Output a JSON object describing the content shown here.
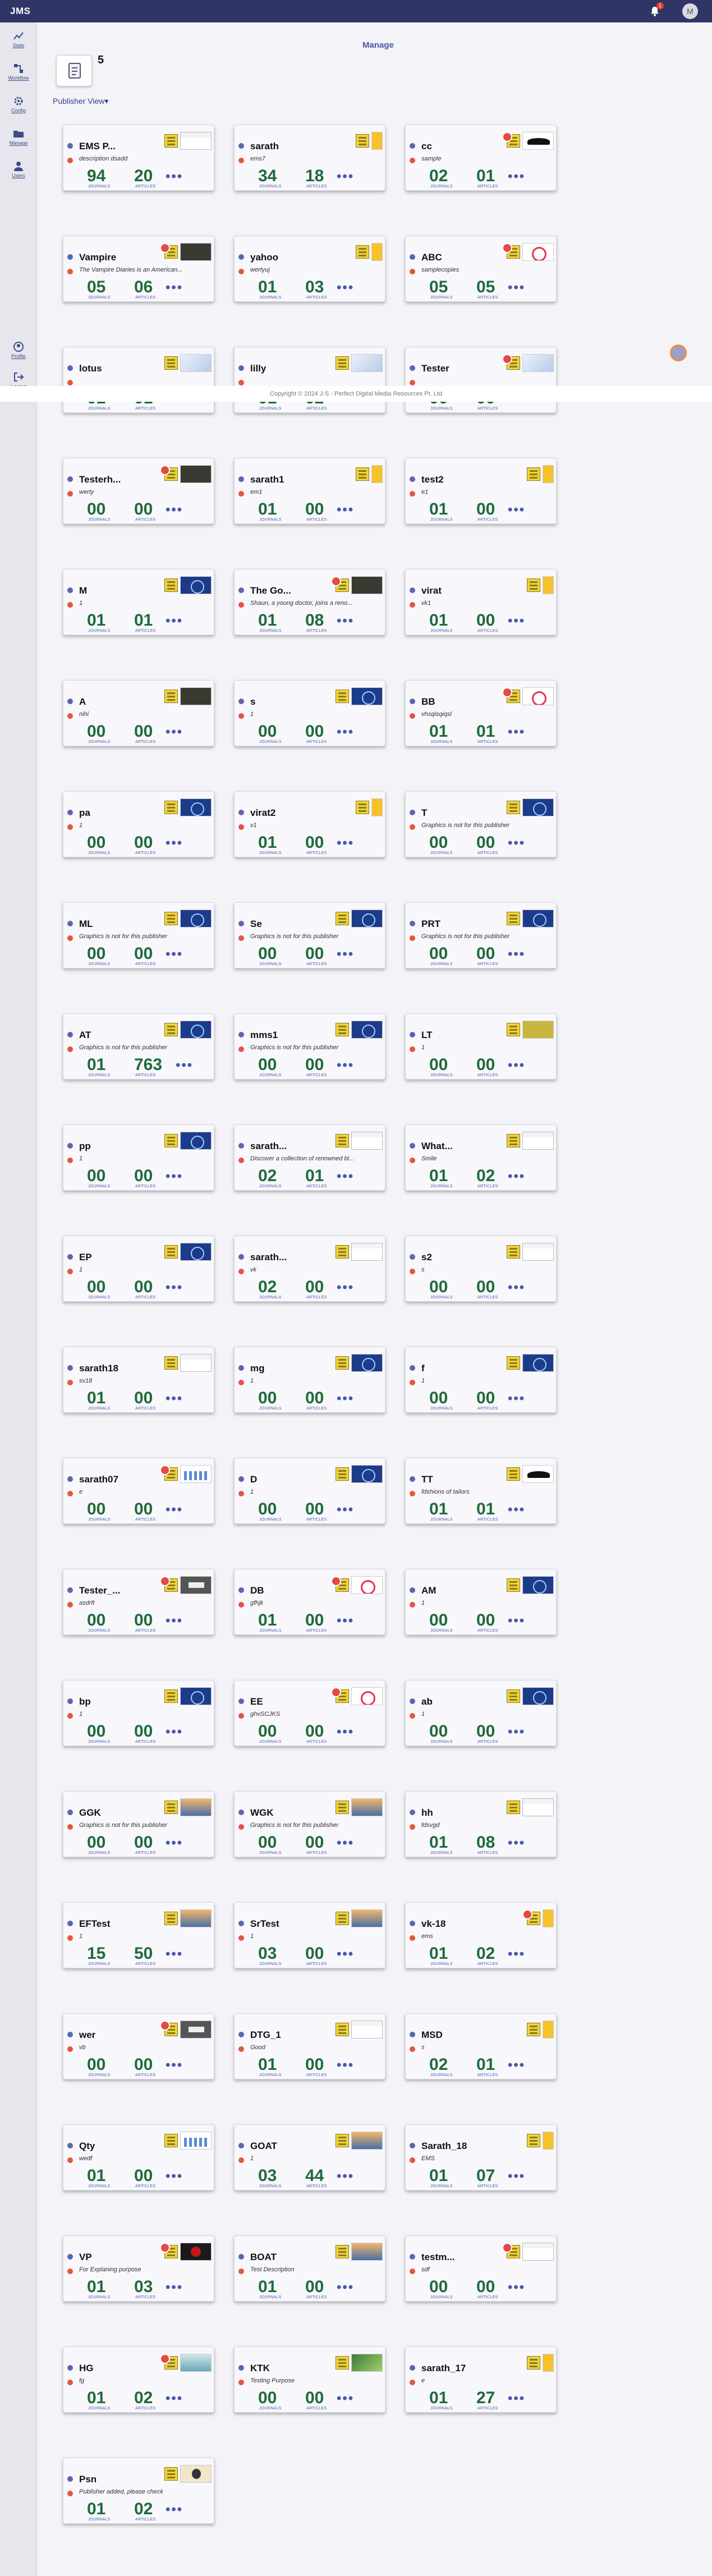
{
  "header": {
    "app_title": "JMS",
    "notification_count": "1",
    "user_initial": "M"
  },
  "sidebar": {
    "items": [
      {
        "label": "Stats",
        "icon": "stats-icon"
      },
      {
        "label": "Workflow",
        "icon": "workflow-icon"
      },
      {
        "label": "Config",
        "icon": "gear-icon"
      },
      {
        "label": "Manage",
        "icon": "folder-icon"
      },
      {
        "label": "Users",
        "icon": "users-icon"
      },
      {
        "label": "Profile",
        "icon": "profile-icon"
      },
      {
        "label": "Logout",
        "icon": "logout-icon"
      }
    ]
  },
  "main": {
    "manage_label": "Manage",
    "publisher_count": "5",
    "view_selector": "Publisher View",
    "view_chevron": "▾"
  },
  "footer": {
    "text": "Copyright © 2024 J-S - Perfect Digital Media Resources Pt. Ltd"
  },
  "labels": {
    "journals": "JOURNALS",
    "articles": "ARTICLES",
    "more": "•••"
  },
  "cards": [
    {
      "name": "EMS P...",
      "description": "description dsadd",
      "journals": "94",
      "articles": "20",
      "red_badge": false,
      "thumb": "screen"
    },
    {
      "name": "sarath",
      "description": "ems7",
      "journals": "34",
      "articles": "18",
      "red_badge": false,
      "thumb": "yellow"
    },
    {
      "name": "cc",
      "description": "sample",
      "journals": "02",
      "articles": "01",
      "red_badge": true,
      "thumb": "bat"
    },
    {
      "name": "Vampire",
      "description": "The Vampire Diaries is an American...",
      "journals": "05",
      "articles": "06",
      "red_badge": true,
      "thumb": "dark"
    },
    {
      "name": "yahoo",
      "description": "wertyuj",
      "journals": "01",
      "articles": "03",
      "red_badge": false,
      "thumb": "yellow"
    },
    {
      "name": "ABC",
      "description": "samplecopies",
      "journals": "05",
      "articles": "05",
      "red_badge": true,
      "thumb": "red"
    },
    {
      "name": "lotus",
      "description": "",
      "journals": "01",
      "articles": "01",
      "red_badge": false,
      "thumb": "plain"
    },
    {
      "name": "lilly",
      "description": "",
      "journals": "01",
      "articles": "02",
      "red_badge": false,
      "thumb": "plain"
    },
    {
      "name": "Tester",
      "description": "",
      "journals": "00",
      "articles": "00",
      "red_badge": true,
      "thumb": "plain"
    },
    {
      "name": "Testerh...",
      "description": "werty",
      "journals": "00",
      "articles": "00",
      "red_badge": true,
      "thumb": "dark"
    },
    {
      "name": "sarath1",
      "description": "em1",
      "journals": "01",
      "articles": "00",
      "red_badge": false,
      "thumb": "yellow"
    },
    {
      "name": "test2",
      "description": "e1",
      "journals": "01",
      "articles": "00",
      "red_badge": false,
      "thumb": "yellow"
    },
    {
      "name": "M",
      "description": "1",
      "journals": "01",
      "articles": "01",
      "red_badge": false,
      "thumb": "globe"
    },
    {
      "name": "The Go...",
      "description": "Shaun, a young doctor, joins a reno...",
      "journals": "01",
      "articles": "08",
      "red_badge": true,
      "thumb": "dark"
    },
    {
      "name": "virat",
      "description": "vk1",
      "journals": "01",
      "articles": "00",
      "red_badge": false,
      "thumb": "yellow"
    },
    {
      "name": "A",
      "description": "nihi",
      "journals": "00",
      "articles": "00",
      "red_badge": false,
      "thumb": "dark"
    },
    {
      "name": "s",
      "description": "1",
      "journals": "00",
      "articles": "00",
      "red_badge": false,
      "thumb": "globe"
    },
    {
      "name": "BB",
      "description": "vhsqisqiqsl",
      "journals": "01",
      "articles": "01",
      "red_badge": true,
      "thumb": "red"
    },
    {
      "name": "pa",
      "description": "1",
      "journals": "00",
      "articles": "00",
      "red_badge": false,
      "thumb": "globe"
    },
    {
      "name": "virat2",
      "description": "v1",
      "journals": "01",
      "articles": "00",
      "red_badge": false,
      "thumb": "yellow"
    },
    {
      "name": "T",
      "description": "Graphics is not for this publisher",
      "journals": "00",
      "articles": "00",
      "red_badge": false,
      "thumb": "globe"
    },
    {
      "name": "ML",
      "description": "Graphics is not for this publisher",
      "journals": "00",
      "articles": "00",
      "red_badge": false,
      "thumb": "globe"
    },
    {
      "name": "Se",
      "description": "Graphics is not for this publisher",
      "journals": "00",
      "articles": "00",
      "red_badge": false,
      "thumb": "globe"
    },
    {
      "name": "PRT",
      "description": "Graphics is not for this publisher",
      "journals": "00",
      "articles": "00",
      "red_badge": false,
      "thumb": "globe"
    },
    {
      "name": "AT",
      "description": "Graphics is not for this publisher",
      "journals": "01",
      "articles": "763",
      "red_badge": false,
      "thumb": "globe"
    },
    {
      "name": "mms1",
      "description": "Graphics is not for this publisher",
      "journals": "00",
      "articles": "00",
      "red_badge": false,
      "thumb": "globe"
    },
    {
      "name": "LT",
      "description": "1",
      "journals": "00",
      "articles": "00",
      "red_badge": false,
      "thumb": "gold"
    },
    {
      "name": "pp",
      "description": "1",
      "journals": "00",
      "articles": "00",
      "red_badge": false,
      "thumb": "globe"
    },
    {
      "name": "sarath...",
      "description": "Discover a collection of renowned bl...",
      "journals": "02",
      "articles": "01",
      "red_badge": false,
      "thumb": "screen"
    },
    {
      "name": "What...",
      "description": "Smile",
      "journals": "01",
      "articles": "02",
      "red_badge": false,
      "thumb": "screen"
    },
    {
      "name": "EP",
      "description": "1",
      "journals": "00",
      "articles": "00",
      "red_badge": false,
      "thumb": "globe"
    },
    {
      "name": "sarath...",
      "description": "vk",
      "journals": "02",
      "articles": "00",
      "red_badge": false,
      "thumb": "screen"
    },
    {
      "name": "s2",
      "description": "s",
      "journals": "00",
      "articles": "00",
      "red_badge": false,
      "thumb": "screen"
    },
    {
      "name": "sarath18",
      "description": "sv18",
      "journals": "01",
      "articles": "00",
      "red_badge": false,
      "thumb": "screen"
    },
    {
      "name": "mg",
      "description": "1",
      "journals": "00",
      "articles": "00",
      "red_badge": false,
      "thumb": "globe"
    },
    {
      "name": "f",
      "description": "1",
      "journals": "00",
      "articles": "00",
      "red_badge": false,
      "thumb": "globe"
    },
    {
      "name": "sarath07",
      "description": "e",
      "journals": "00",
      "articles": "00",
      "red_badge": true,
      "thumb": "chart"
    },
    {
      "name": "D",
      "description": "1",
      "journals": "00",
      "articles": "00",
      "red_badge": false,
      "thumb": "globe"
    },
    {
      "name": "TT",
      "description": "fdshions of tailors",
      "journals": "01",
      "articles": "01",
      "red_badge": false,
      "thumb": "bat"
    },
    {
      "name": "Tester_...",
      "description": "asdrft",
      "journals": "00",
      "articles": "00",
      "red_badge": true,
      "thumb": "gray"
    },
    {
      "name": "DB",
      "description": "gfhjk",
      "journals": "01",
      "articles": "00",
      "red_badge": true,
      "thumb": "red"
    },
    {
      "name": "AM",
      "description": "1",
      "journals": "00",
      "articles": "00",
      "red_badge": false,
      "thumb": "globe"
    },
    {
      "name": "bp",
      "description": "1",
      "journals": "00",
      "articles": "00",
      "red_badge": false,
      "thumb": "globe"
    },
    {
      "name": "EE",
      "description": "ghvSCJKS",
      "journals": "00",
      "articles": "00",
      "red_badge": true,
      "thumb": "red"
    },
    {
      "name": "ab",
      "description": "1",
      "journals": "00",
      "articles": "00",
      "red_badge": false,
      "thumb": "globe"
    },
    {
      "name": "GGK",
      "description": "Graphics is not for this publisher",
      "journals": "00",
      "articles": "00",
      "red_badge": false,
      "thumb": "sky"
    },
    {
      "name": "WGK",
      "description": "Graphics is not for this publisher",
      "journals": "00",
      "articles": "00",
      "red_badge": false,
      "thumb": "sky"
    },
    {
      "name": "hh",
      "description": "fdsvgd",
      "journals": "01",
      "articles": "08",
      "red_badge": false,
      "thumb": "screen"
    },
    {
      "name": "EFTest",
      "description": "1",
      "journals": "15",
      "articles": "50",
      "red_badge": false,
      "thumb": "sky"
    },
    {
      "name": "SrTest",
      "description": "1",
      "journals": "03",
      "articles": "00",
      "red_badge": false,
      "thumb": "sky"
    },
    {
      "name": "vk-18",
      "description": "ems",
      "journals": "01",
      "articles": "02",
      "red_badge": true,
      "thumb": "yellow"
    },
    {
      "name": "wer",
      "description": "vb",
      "journals": "00",
      "articles": "00",
      "red_badge": true,
      "thumb": "gray"
    },
    {
      "name": "DTG_1",
      "description": "Good",
      "journals": "01",
      "articles": "00",
      "red_badge": false,
      "thumb": "screen"
    },
    {
      "name": "MSD",
      "description": "s",
      "journals": "02",
      "articles": "01",
      "red_badge": false,
      "thumb": "yellow"
    },
    {
      "name": "Qty",
      "description": "wedf",
      "journals": "01",
      "articles": "00",
      "red_badge": false,
      "thumb": "chart"
    },
    {
      "name": "GOAT",
      "description": "1",
      "journals": "03",
      "articles": "44",
      "red_badge": false,
      "thumb": "sky"
    },
    {
      "name": "Sarath_18",
      "description": "EMS",
      "journals": "01",
      "articles": "07",
      "red_badge": false,
      "thumb": "yellow"
    },
    {
      "name": "VP",
      "description": "For Explaning purpose",
      "journals": "01",
      "articles": "03",
      "red_badge": true,
      "thumb": "rose"
    },
    {
      "name": "BOAT",
      "description": "Test Description",
      "journals": "01",
      "articles": "00",
      "red_badge": false,
      "thumb": "sky"
    },
    {
      "name": "testm...",
      "description": "sdf",
      "journals": "00",
      "articles": "00",
      "red_badge": true,
      "thumb": "screen"
    },
    {
      "name": "HG",
      "description": "fg",
      "journals": "01",
      "articles": "02",
      "red_badge": true,
      "thumb": "sea"
    },
    {
      "name": "KTK",
      "description": "Testing Purpose",
      "journals": "00",
      "articles": "00",
      "red_badge": false,
      "thumb": "green"
    },
    {
      "name": "sarath_17",
      "description": "e",
      "journals": "01",
      "articles": "27",
      "red_badge": false,
      "thumb": "yellow"
    },
    {
      "name": "Psn",
      "description": "Publisher added, please check",
      "journals": "01",
      "articles": "02",
      "red_badge": false,
      "thumb": "mono"
    }
  ]
}
